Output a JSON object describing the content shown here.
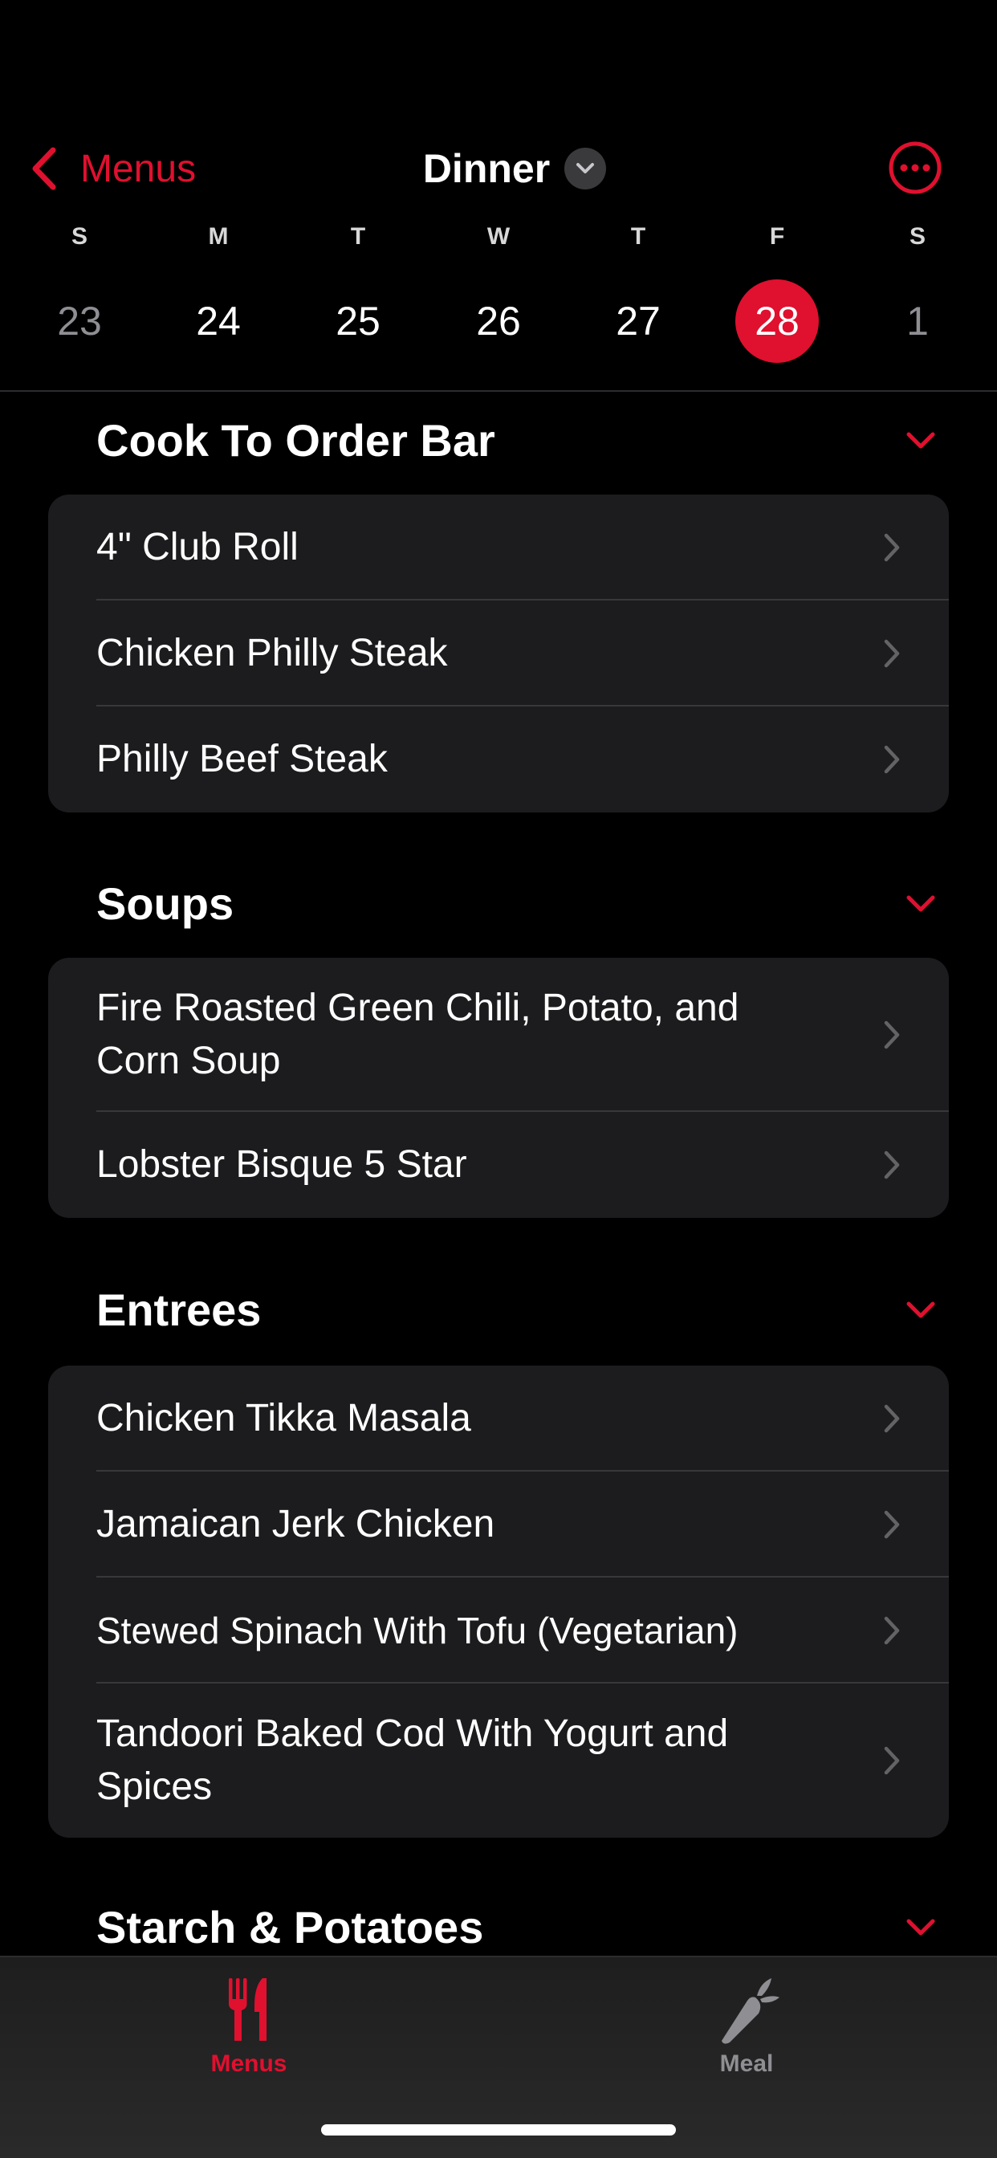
{
  "header": {
    "back_label": "Menus",
    "title": "Dinner"
  },
  "week": {
    "days": [
      {
        "dow": "S",
        "num": "23"
      },
      {
        "dow": "M",
        "num": "24"
      },
      {
        "dow": "T",
        "num": "25"
      },
      {
        "dow": "W",
        "num": "26"
      },
      {
        "dow": "T",
        "num": "27"
      },
      {
        "dow": "F",
        "num": "28"
      },
      {
        "dow": "S",
        "num": "1"
      }
    ],
    "selected_index": 5
  },
  "sections": [
    {
      "title": "Cook To Order Bar",
      "items": [
        "4\" Club Roll",
        "Chicken Philly Steak",
        "Philly Beef Steak"
      ]
    },
    {
      "title": "Soups",
      "items": [
        "Fire Roasted Green Chili, Potato, and Corn Soup",
        "Lobster Bisque 5 Star"
      ]
    },
    {
      "title": "Entrees",
      "items": [
        "Chicken Tikka Masala",
        "Jamaican Jerk Chicken",
        "Stewed Spinach With Tofu (Vegetarian)",
        "Tandoori Baked Cod With Yogurt and Spices"
      ]
    },
    {
      "title": "Starch & Potatoes",
      "items": []
    }
  ],
  "tabs": [
    {
      "label": "Menus",
      "icon": "fork-knife-icon",
      "active": true
    },
    {
      "label": "Meal",
      "icon": "carrot-icon",
      "active": false
    }
  ],
  "colors": {
    "accent": "#e0102f",
    "background": "#000000",
    "card": "#1c1c1e",
    "inactive_tab": "#8e8e93"
  }
}
